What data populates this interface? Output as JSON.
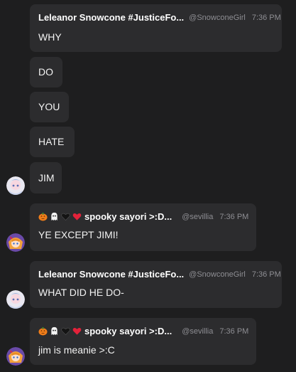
{
  "messages": [
    {
      "name": "Leleanor Snowcone #JusticeFo...",
      "handle": "@SnowconeGirl",
      "time": "7:36 PM",
      "text": "WHY"
    },
    {
      "text": "DO"
    },
    {
      "text": "YOU"
    },
    {
      "text": "HATE"
    },
    {
      "text": "JIM"
    },
    {
      "emojis": [
        "jack-o-lantern",
        "ghost",
        "black-heart",
        "red-heart"
      ],
      "name": "spooky sayori >:D...",
      "handle": "@sevillia",
      "time": "7:36 PM",
      "text": "YE EXCEPT JIMI!"
    },
    {
      "name": "Leleanor Snowcone #JusticeFo...",
      "handle": "@SnowconeGirl",
      "time": "7:36 PM",
      "text": "WHAT DID HE DO-"
    },
    {
      "emojis": [
        "jack-o-lantern",
        "ghost",
        "black-heart",
        "red-heart"
      ],
      "name": "spooky sayori >:D...",
      "handle": "@sevillia",
      "time": "7:36 PM",
      "text": "jim is meanie >:C"
    }
  ],
  "colors": {
    "background": "#1e1e1f",
    "bubble": "#2c2c2e",
    "meta": "#8e8e93"
  }
}
